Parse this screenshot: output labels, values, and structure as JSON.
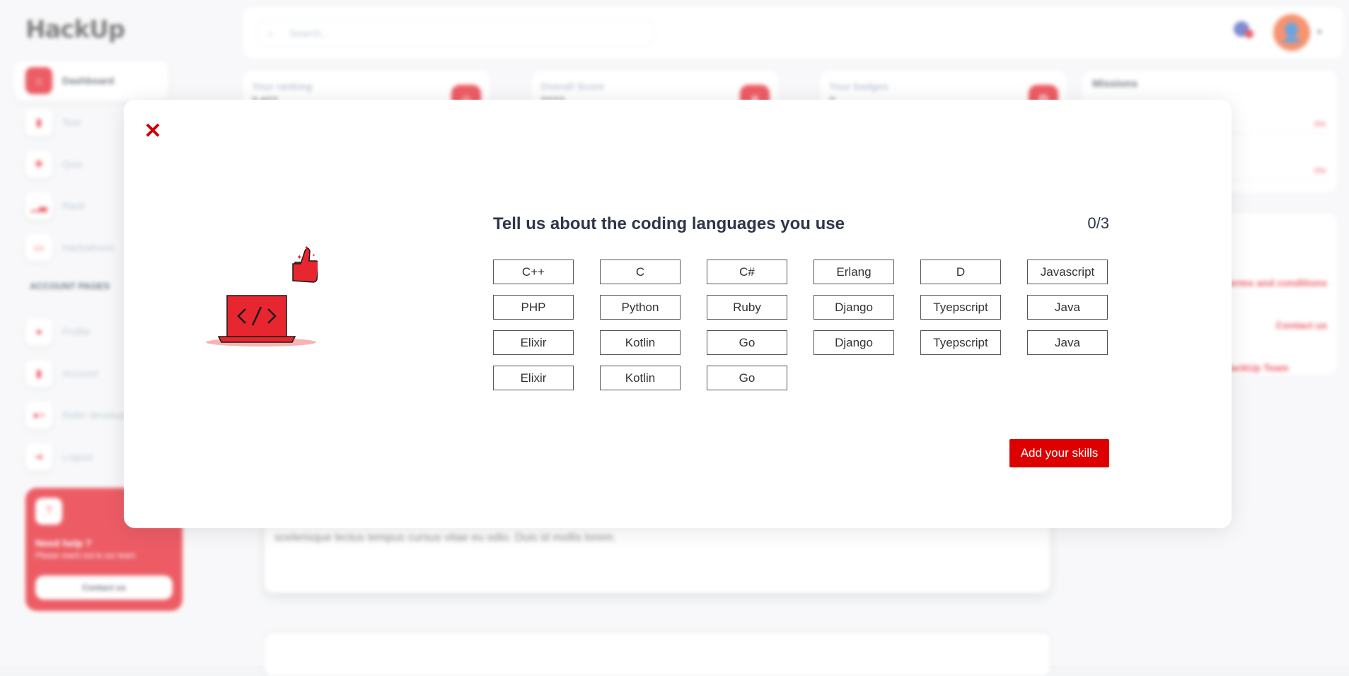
{
  "app": {
    "logo": "HackUp"
  },
  "sidebar": {
    "items": [
      {
        "label": "Dashboard",
        "icon": "home-icon",
        "active": true
      },
      {
        "label": "Test",
        "icon": "document-icon"
      },
      {
        "label": "Quiz",
        "icon": "puzzle-icon"
      },
      {
        "label": "Rank",
        "icon": "chart-icon"
      },
      {
        "label": "Hackathons",
        "icon": "laptop-icon"
      }
    ],
    "account_heading": "ACCOUNT PAGES",
    "account_items": [
      {
        "label": "Profile",
        "icon": "user-icon"
      },
      {
        "label": "Account",
        "icon": "document-icon"
      },
      {
        "label": "Refer developer",
        "icon": "user-plus-icon"
      },
      {
        "label": "Logout",
        "icon": "logout-icon"
      }
    ],
    "help": {
      "title": "Need help ?",
      "subtitle": "Please reach out to our team",
      "button": "Contact us"
    }
  },
  "header": {
    "search_placeholder": "Search..."
  },
  "stats": [
    {
      "label": "Your ranking",
      "value": "2,4??"
    },
    {
      "label": "Overall Score",
      "value": "????"
    },
    {
      "label": "Your badges",
      "value": "?"
    }
  ],
  "missions": {
    "title": "Missions",
    "percent_a": "0%",
    "percent_b": "0%"
  },
  "info_links": {
    "terms": "Terms and conditions",
    "contact": "Contact us",
    "team": "HackUp Team"
  },
  "main_card": {
    "text": "scelerisque lectus tempus cursus vitae eu odio. Duis id mollis lorem."
  },
  "modal": {
    "title": "Tell us about the coding languages you use",
    "counter": "0/3",
    "languages": [
      "C++",
      "C",
      "C#",
      "Erlang",
      "D",
      "Javascript",
      "PHP",
      "Python",
      "Ruby",
      "Django",
      "Tyepscript",
      "Java",
      "Elixir",
      "Kotlin",
      "Go",
      "Django",
      "Tyepscript",
      "Java",
      "Elixir",
      "Kotlin",
      "Go"
    ],
    "submit_label": "Add your skills",
    "accent": "#dd0000"
  }
}
